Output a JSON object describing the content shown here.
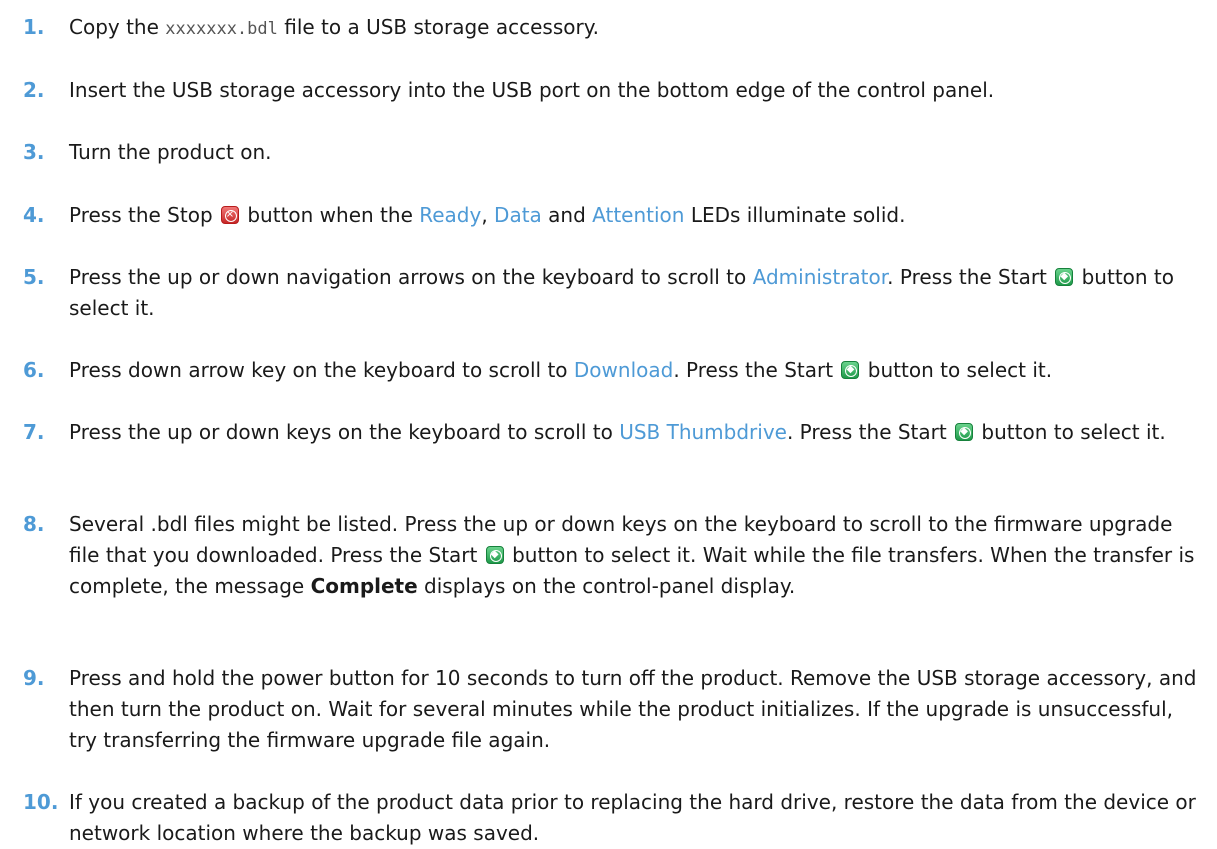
{
  "steps": [
    {
      "num": "1.",
      "parts": [
        {
          "t": "Copy the "
        },
        {
          "t": "xxxxxxx.bdl",
          "style": "mono"
        },
        {
          "t": " file to a USB storage accessory."
        }
      ]
    },
    {
      "num": "2.",
      "parts": [
        {
          "t": "Insert the USB storage accessory into the USB port on the bottom edge of the control panel."
        }
      ]
    },
    {
      "num": "3.",
      "parts": [
        {
          "t": "Turn the product on."
        }
      ]
    },
    {
      "num": "4.",
      "parts": [
        {
          "t": "Press the Stop "
        },
        {
          "icon": "stop-button-icon"
        },
        {
          "t": " button when the "
        },
        {
          "t": "Ready",
          "style": "ui"
        },
        {
          "t": ", "
        },
        {
          "t": "Data",
          "style": "ui"
        },
        {
          "t": " and "
        },
        {
          "t": "Attention",
          "style": "ui"
        },
        {
          "t": " LEDs illuminate solid."
        }
      ]
    },
    {
      "num": "5.",
      "parts": [
        {
          "t": "Press the up or down navigation arrows on the keyboard to scroll to "
        },
        {
          "t": "Administrator",
          "style": "ui"
        },
        {
          "t": ". Press the Start "
        },
        {
          "icon": "start-button-icon"
        },
        {
          "t": " button to select it."
        }
      ]
    },
    {
      "num": "6.",
      "parts": [
        {
          "t": "Press down arrow key on the keyboard to scroll to "
        },
        {
          "t": "Download",
          "style": "ui"
        },
        {
          "t": ". Press the Start "
        },
        {
          "icon": "start-button-icon"
        },
        {
          "t": " button to select it."
        }
      ]
    },
    {
      "num": "7.",
      "parts": [
        {
          "t": "Press the up or down keys on the keyboard to scroll to "
        },
        {
          "t": "USB Thumbdrive",
          "style": "ui"
        },
        {
          "t": ". Press the Start "
        },
        {
          "icon": "start-button-icon"
        },
        {
          "t": " button to select it."
        }
      ]
    },
    {
      "num": "8.",
      "parts": [
        {
          "t": "Several .bdl files might be listed. Press the up or down keys on the keyboard to scroll to the firmware upgrade file that you downloaded. Press the Start "
        },
        {
          "icon": "start-button-icon"
        },
        {
          "t": " button to select it. Wait while the file transfers. When the transfer is complete, the message "
        },
        {
          "t": "Complete",
          "style": "bold"
        },
        {
          "t": " displays on the control-panel display."
        }
      ]
    },
    {
      "num": "9.",
      "parts": [
        {
          "t": "Press and hold the power button for 10 seconds to turn off the product. Remove the USB storage accessory, and then turn the product on. Wait for several minutes while the product initializes. If the upgrade is unsuccessful, try transferring the firmware upgrade file again."
        }
      ]
    },
    {
      "num": "10.",
      "parts": [
        {
          "t": "If you created a backup of the product data prior to replacing the hard drive, restore the data from the device or network location where the backup was saved."
        }
      ]
    }
  ]
}
